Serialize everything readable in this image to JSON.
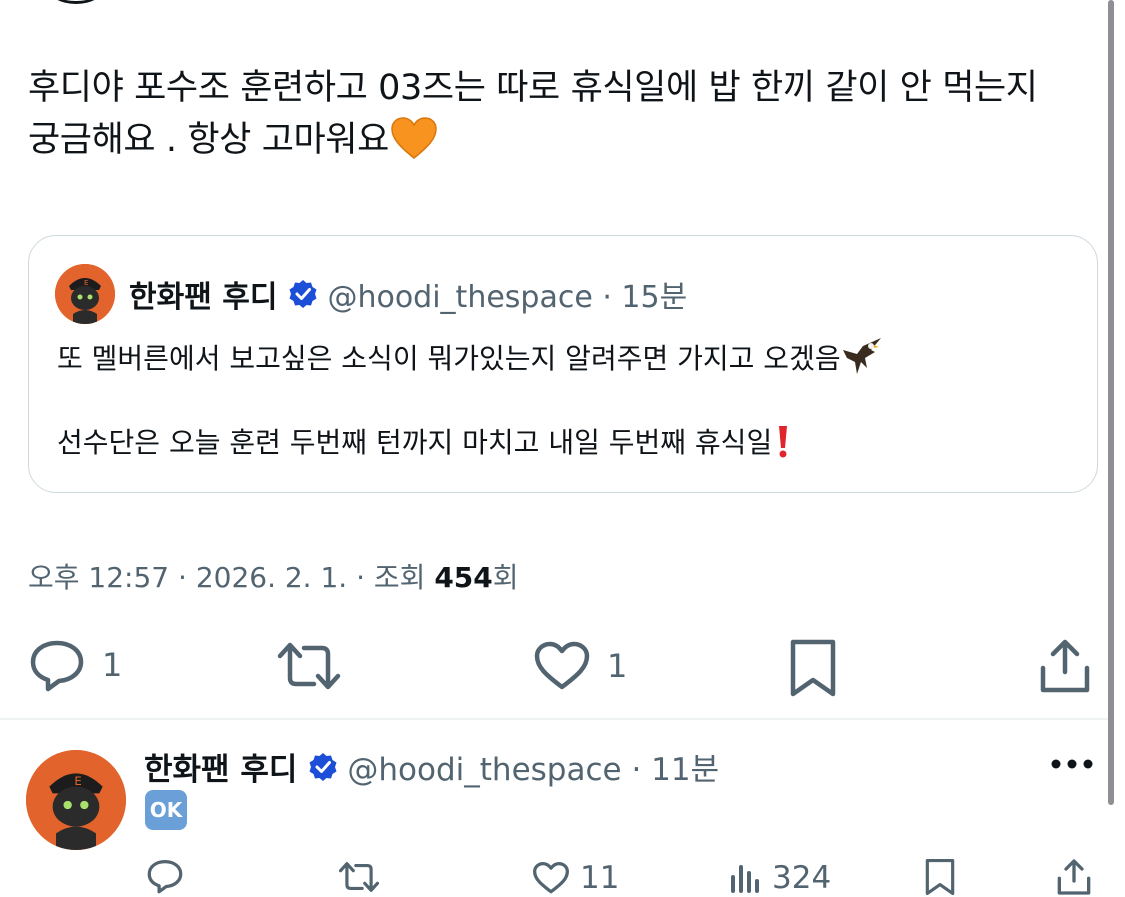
{
  "post": {
    "text_line1": "후디야 포수조 훈련하고 03즈는 따로 휴식일에 밥 한끼 같이 안 먹는지",
    "text_line2": "궁금해요 . 항상 고마워요",
    "heart_icon": "orange-heart-icon",
    "timestamp": "오후 12:57 · 2026. 2. 1. · 조회 ",
    "views": "454",
    "views_suffix": "회"
  },
  "quote": {
    "name": "한화팬 후디",
    "handle": "@hoodi_thespace · 15분",
    "line1": "또 멜버른에서 보고싶은 소식이 뭐가있는지 알려주면 가지고 오겠음",
    "line2": "선수단은 오늘 훈련 두번째 턴까지 마치고 내일 두번째 휴식일",
    "colors": {
      "border": "#cfd9de",
      "verified": "#1d4ed8"
    }
  },
  "actions": {
    "reply_count": "1",
    "like_count": "1"
  },
  "reply": {
    "name": "한화팬 후디",
    "handle": "@hoodi_thespace · 11분",
    "emoji_text": "OK",
    "like_count": "11",
    "view_count": "324"
  },
  "colors": {
    "text": "#0f1419",
    "muted": "#536471",
    "avatar_bg": "#e2642c"
  }
}
